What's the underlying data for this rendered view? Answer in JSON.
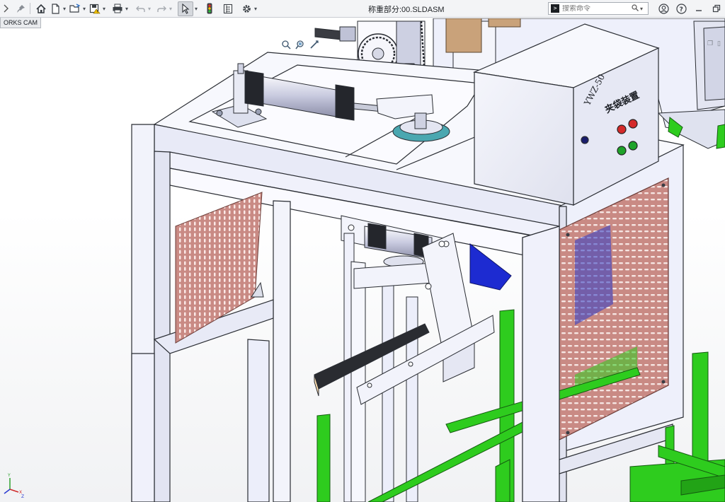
{
  "app": {
    "document_title": "称重部分:00.SLDASM",
    "tab_label": "ORKS CAM"
  },
  "toolbar": {
    "items": [
      "pin-icon",
      "home-icon",
      "new-document-icon",
      "open-icon",
      "save-icon",
      "print-icon",
      "undo-icon",
      "redo-icon",
      "select-icon",
      "traffic-light-icon",
      "file-properties-icon",
      "options-icon"
    ]
  },
  "search": {
    "placeholder": "搜索命令"
  },
  "right_icons": [
    "account-icon",
    "help-icon",
    "minimize-icon",
    "restore-icon"
  ],
  "model": {
    "control_box_label_line1": "YWZ-50",
    "control_box_label_line2": "夹袋装置"
  },
  "colors": {
    "frame": "#eef0fb",
    "frame_edge": "#2a2d33",
    "mesh": "#c98a84",
    "green_frame": "#2ecc1e",
    "blue_hopper": "#1d2bd1",
    "toolbar_bg": "#f3f4f6"
  },
  "triad": {
    "x_label": "X",
    "y_label": "Y",
    "z_label": "Z"
  }
}
